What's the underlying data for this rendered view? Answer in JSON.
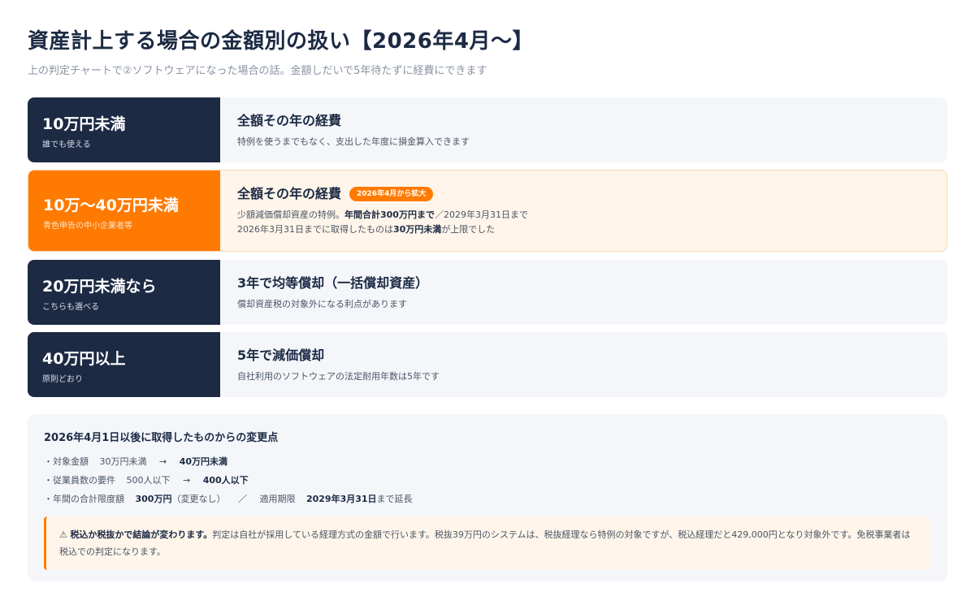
{
  "page": {
    "title": "資産計上する場合の金額別の扱い【2026年4月〜】",
    "subtitle": "上の判定チャートで②ソフトウェアになった場合の話。金額しだいで5年待たずに経費にできます"
  },
  "rows": [
    {
      "amount": "10万円未満",
      "note": "誰でも使える",
      "head": "全額その年の経費",
      "desc": "特例を使うまでもなく、支出した年度に損金算入できます"
    },
    {
      "amount": "10万〜40万円未満",
      "note": "青色申告の中小企業者等",
      "head": "全額その年の経費",
      "badge": "2026年4月から拡大",
      "line1_a": "少額減価償却資産の特例。",
      "line1_b": "年間合計300万円まで",
      "line1_c": "／2029年3月31日まで",
      "line2_a": "2026年3月31日までに取得したものは",
      "line2_b": "30万円未満",
      "line2_c": "が上限でした"
    },
    {
      "amount": "20万円未満なら",
      "note": "こちらも選べる",
      "head": "3年で均等償却（一括償却資産）",
      "desc": "償却資産税の対象外になる利点があります"
    },
    {
      "amount": "40万円以上",
      "note": "原則どおり",
      "head": "5年で減価償却",
      "desc": "自社利用のソフトウェアの法定耐用年数は5年です"
    }
  ],
  "changes": {
    "title": "2026年4月1日以後に取得したものからの変更点",
    "items": [
      {
        "label": "・対象金額",
        "old": "30万円未満",
        "arrow": "→",
        "new": "40万円未満"
      },
      {
        "label": "・従業員数の要件",
        "old": "500人以下",
        "arrow": "→",
        "new": "400人以下"
      }
    ],
    "item3": {
      "label": "・年間の合計限度額",
      "value": "300万円",
      "value_note": "（変更なし）",
      "sep": "／",
      "period_label": "適用期限",
      "period": "2029年3月31日",
      "period_tail": "まで延長"
    },
    "warning": {
      "icon": "⚠",
      "bold": "税込か税抜かで結論が変わります。",
      "text": "判定は自社が採用している経理方式の金額で行います。税抜39万円のシステムは、税抜経理なら特例の対象ですが、税込経理だと429,000円となり対象外です。免税事業者は税込での判定になります。"
    }
  },
  "colors": {
    "navy": "#1c2a44",
    "orange": "#ff7a00",
    "panel": "#f4f6fa",
    "highlight_bg": "#fff5ea"
  }
}
